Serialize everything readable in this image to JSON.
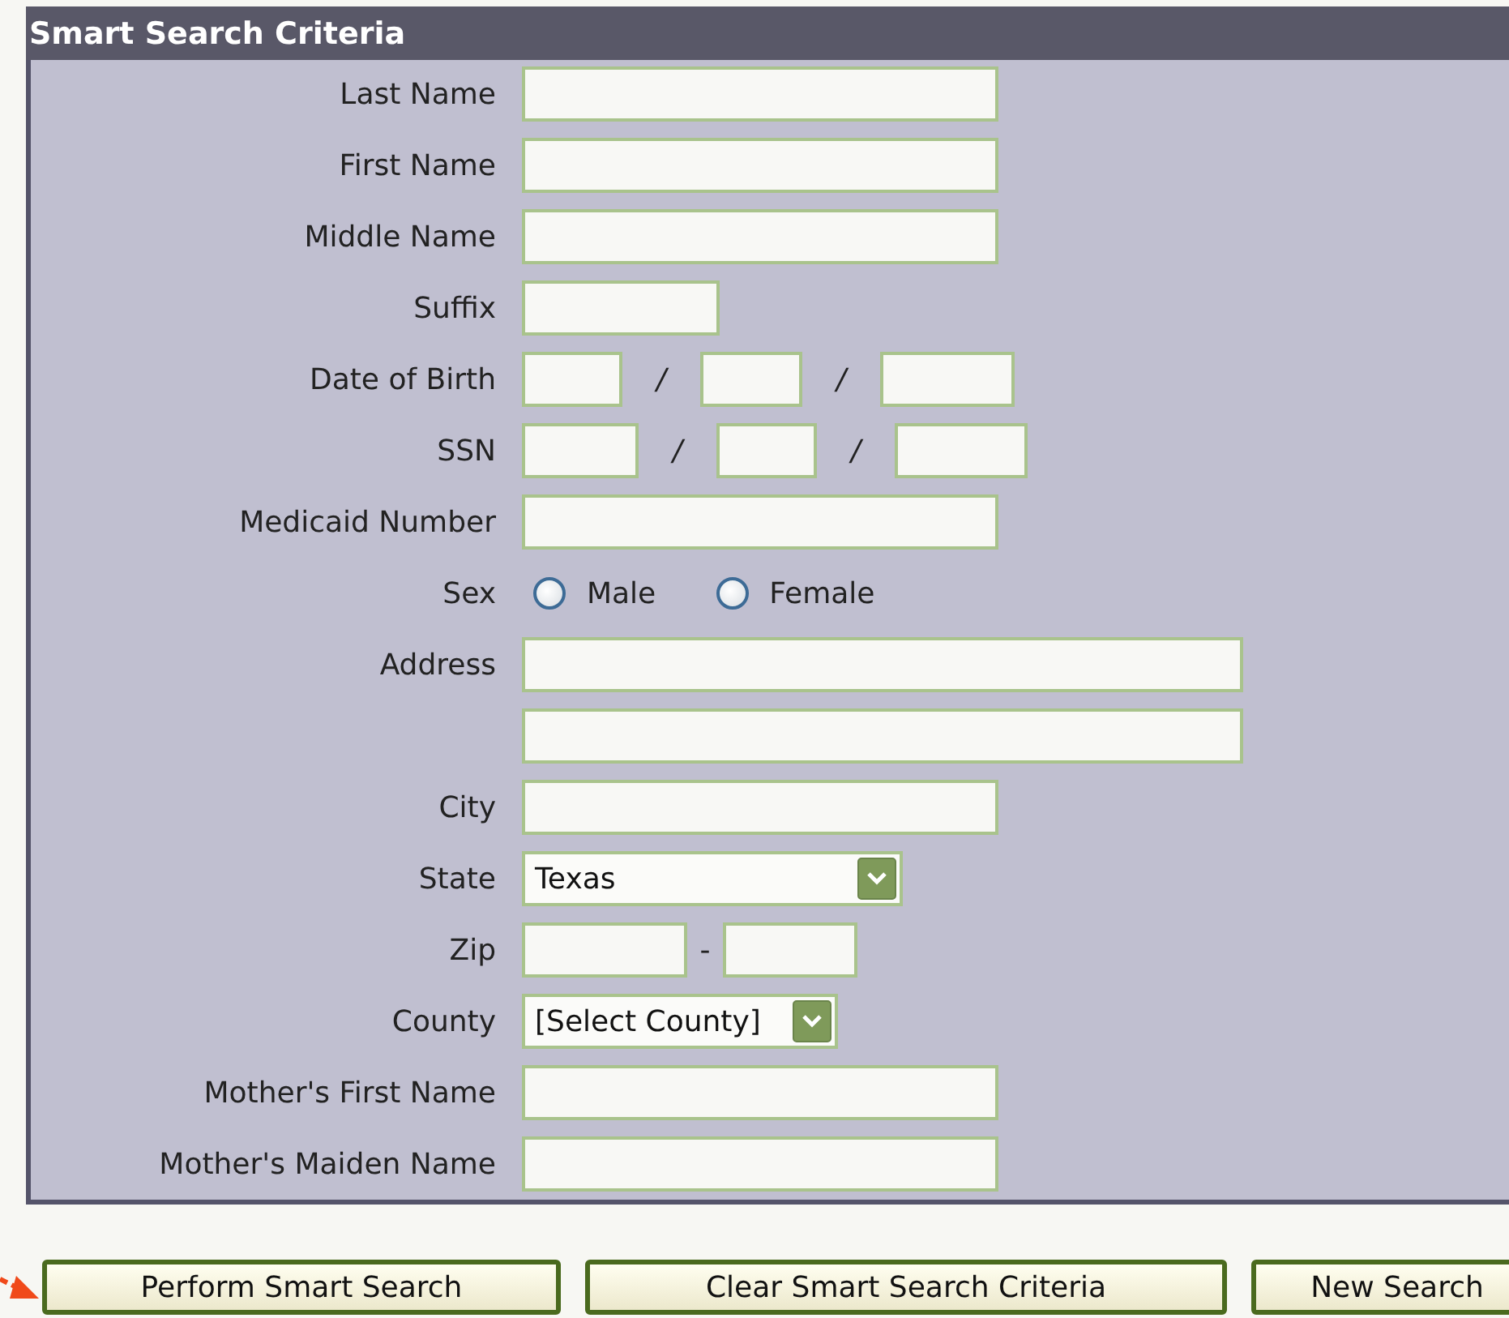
{
  "panel": {
    "title": "Smart Search Criteria",
    "rows": [
      {
        "label": "Last Name",
        "kind": "text"
      },
      {
        "label": "First Name",
        "kind": "text"
      },
      {
        "label": "Middle Name",
        "kind": "text"
      },
      {
        "label": "Suffix",
        "kind": "text"
      },
      {
        "label": "Date of Birth",
        "kind": "split",
        "separators": [
          "/",
          "/"
        ]
      },
      {
        "label": "SSN",
        "kind": "split",
        "separators": [
          "/",
          "/"
        ]
      },
      {
        "label": "Medicaid Number",
        "kind": "text"
      },
      {
        "label": "Sex",
        "kind": "radio",
        "options": [
          {
            "label": "Male",
            "selected": false
          },
          {
            "label": "Female",
            "selected": false
          }
        ]
      },
      {
        "label": "Address",
        "kind": "text"
      },
      {
        "kind": "text"
      },
      {
        "label": "City",
        "kind": "text"
      },
      {
        "label": "State",
        "kind": "select",
        "value": "Texas"
      },
      {
        "label": "Zip",
        "kind": "split",
        "separators": [
          "-"
        ]
      },
      {
        "label": "County",
        "kind": "select",
        "value": "[Select County]"
      },
      {
        "label": "Mother's First Name",
        "kind": "text"
      },
      {
        "label": "Mother's Maiden Name",
        "kind": "text"
      }
    ]
  },
  "buttons": [
    "Perform Smart Search",
    "Clear Smart Search Criteria",
    "New Search"
  ]
}
